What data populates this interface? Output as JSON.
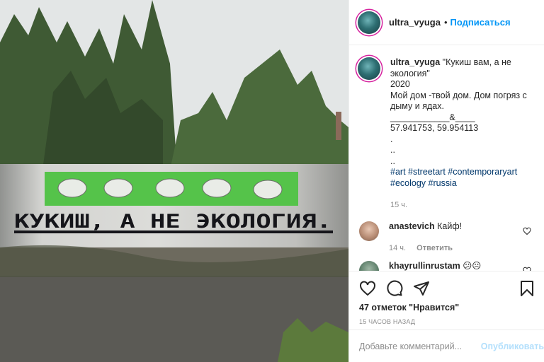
{
  "post": {
    "username": "ultra_vyuga",
    "follow_label": "Подписаться",
    "dot": "•",
    "caption_lines": [
      "\"Кукиш вам, а не экология\"",
      "2020",
      "Мой дом -твой дом. Дом погряз с дыму и ядах.",
      "____________&____",
      "57.941753, 59.954113",
      ".",
      "..",
      ".."
    ],
    "hashtags": "#art #streetart #contemporaryart #ecology #russia",
    "caption_time": "15 ч.",
    "likes": "47 отметок \"Нравится\"",
    "posted_ago": "15 ЧАСОВ НАЗАД"
  },
  "comments": [
    {
      "user": "anastevich",
      "text": "Кайф!",
      "time": "14 ч.",
      "reply": "Ответить"
    },
    {
      "user": "khayrullinrustam",
      "text": "😕☹"
    }
  ],
  "comment_box": {
    "placeholder": "Добавьте комментарий...",
    "publish": "Опубликовать"
  },
  "mural": {
    "text": "КУКИШ, А НЕ ЭКОЛОГИЯ."
  },
  "colors": {
    "accent": "#0095f6",
    "mural_green": "#55c34a",
    "link_dark": "#00376b"
  },
  "icons": [
    "heart-icon",
    "comment-icon",
    "share-icon",
    "bookmark-icon",
    "small-heart-icon"
  ]
}
